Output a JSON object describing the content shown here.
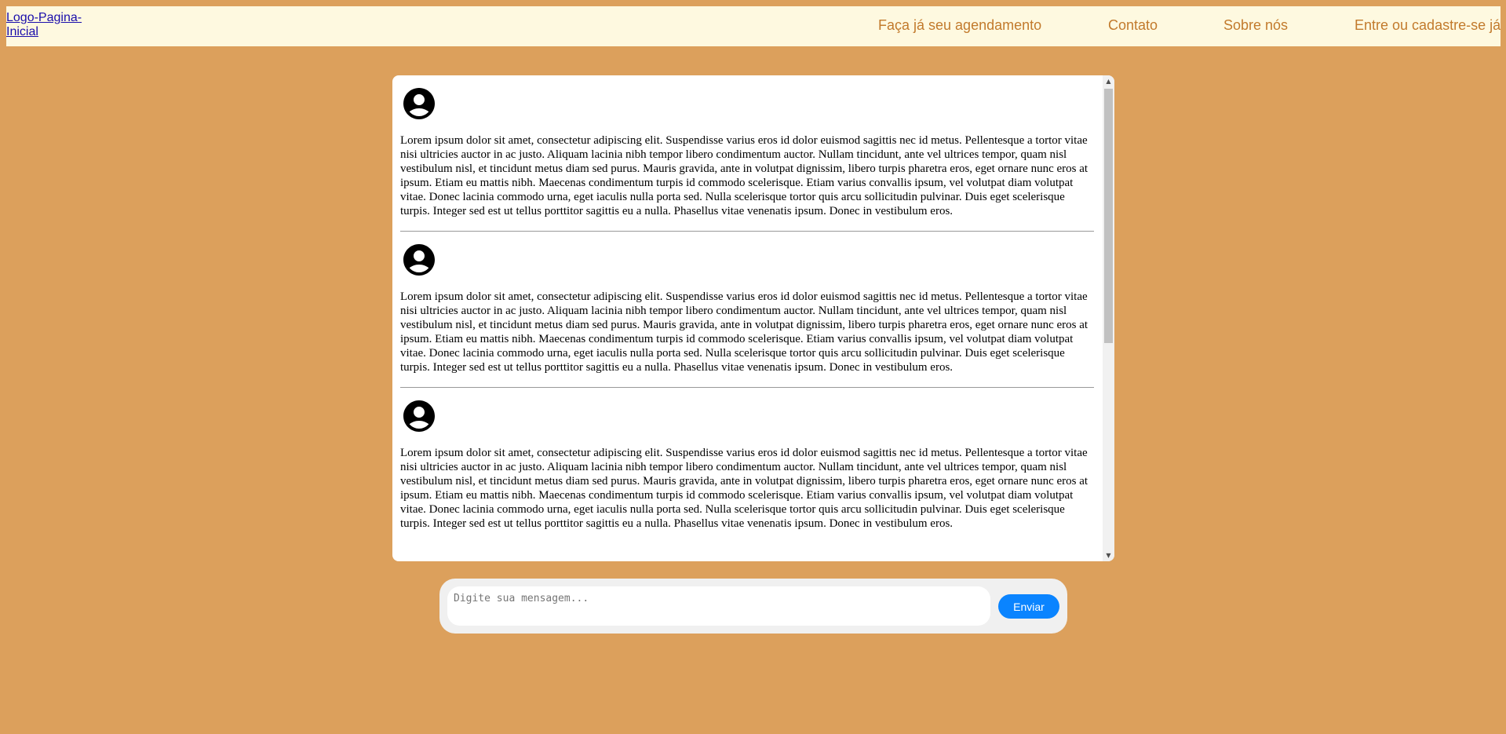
{
  "header": {
    "logo_alt": "Logo-Pagina-Inicial",
    "nav": [
      {
        "label": "Faça já seu agendamento"
      },
      {
        "label": "Contato"
      },
      {
        "label": "Sobre nós"
      },
      {
        "label": "Entre ou cadastre-se já"
      }
    ]
  },
  "chat": {
    "messages": [
      {
        "avatar_icon": "account-circle-icon",
        "text": "Lorem ipsum dolor sit amet, consectetur adipiscing elit. Suspendisse varius eros id dolor euismod sagittis nec id metus. Pellentesque a tortor vitae nisi ultricies auctor in ac justo. Aliquam lacinia nibh tempor libero condimentum auctor. Nullam tincidunt, ante vel ultrices tempor, quam nisl vestibulum nisl, et tincidunt metus diam sed purus. Mauris gravida, ante in volutpat dignissim, libero turpis pharetra eros, eget ornare nunc eros at ipsum. Etiam eu mattis nibh. Maecenas condimentum turpis id commodo scelerisque. Etiam varius convallis ipsum, vel volutpat diam volutpat vitae. Donec lacinia commodo urna, eget iaculis nulla porta sed. Nulla scelerisque tortor quis arcu sollicitudin pulvinar. Duis eget scelerisque turpis. Integer sed est ut tellus porttitor sagittis eu a nulla. Phasellus vitae venenatis ipsum. Donec in vestibulum eros."
      },
      {
        "avatar_icon": "account-circle-icon",
        "text": "Lorem ipsum dolor sit amet, consectetur adipiscing elit. Suspendisse varius eros id dolor euismod sagittis nec id metus. Pellentesque a tortor vitae nisi ultricies auctor in ac justo. Aliquam lacinia nibh tempor libero condimentum auctor. Nullam tincidunt, ante vel ultrices tempor, quam nisl vestibulum nisl, et tincidunt metus diam sed purus. Mauris gravida, ante in volutpat dignissim, libero turpis pharetra eros, eget ornare nunc eros at ipsum. Etiam eu mattis nibh. Maecenas condimentum turpis id commodo scelerisque. Etiam varius convallis ipsum, vel volutpat diam volutpat vitae. Donec lacinia commodo urna, eget iaculis nulla porta sed. Nulla scelerisque tortor quis arcu sollicitudin pulvinar. Duis eget scelerisque turpis. Integer sed est ut tellus porttitor sagittis eu a nulla. Phasellus vitae venenatis ipsum. Donec in vestibulum eros."
      },
      {
        "avatar_icon": "account-circle-icon",
        "text": "Lorem ipsum dolor sit amet, consectetur adipiscing elit. Suspendisse varius eros id dolor euismod sagittis nec id metus. Pellentesque a tortor vitae nisi ultricies auctor in ac justo. Aliquam lacinia nibh tempor libero condimentum auctor. Nullam tincidunt, ante vel ultrices tempor, quam nisl vestibulum nisl, et tincidunt metus diam sed purus. Mauris gravida, ante in volutpat dignissim, libero turpis pharetra eros, eget ornare nunc eros at ipsum. Etiam eu mattis nibh. Maecenas condimentum turpis id commodo scelerisque. Etiam varius convallis ipsum, vel volutpat diam volutpat vitae. Donec lacinia commodo urna, eget iaculis nulla porta sed. Nulla scelerisque tortor quis arcu sollicitudin pulvinar. Duis eget scelerisque turpis. Integer sed est ut tellus porttitor sagittis eu a nulla. Phasellus vitae venenatis ipsum. Donec in vestibulum eros."
      }
    ]
  },
  "composer": {
    "placeholder": "Digite sua mensagem...",
    "value": "",
    "send_label": "Enviar"
  },
  "colors": {
    "page_background": "#dca05c",
    "header_background": "#fef9e0",
    "nav_text": "#c27a2c",
    "send_button": "#0a84ff",
    "input_bar": "#f0f0f0"
  }
}
